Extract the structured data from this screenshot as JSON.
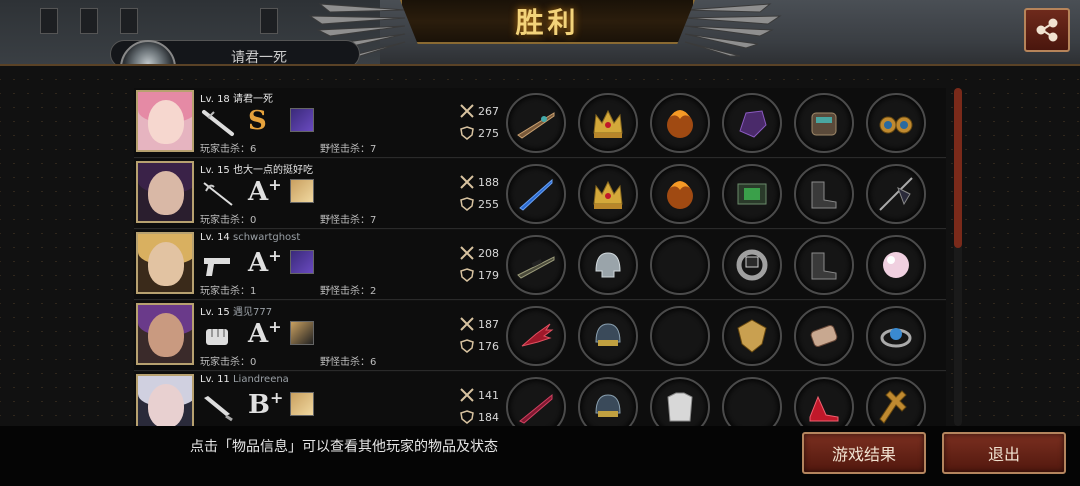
{
  "header": {
    "title": "胜利",
    "team_name": "请君一死"
  },
  "players": [
    {
      "level_text": "Lv. 18",
      "name": "请君一死",
      "name_is_latin": false,
      "weapon": "baton-icon",
      "rank": "S",
      "rank_plus": "",
      "player_kills": "玩家击杀：6",
      "monster_kills": "野怪击杀：7",
      "attack": "267",
      "defense": "275",
      "items": [
        "rifle-icon",
        "crown-icon",
        "flame-fist-icon",
        "purple-gauntlet-icon",
        "armored-glove-icon",
        "goggles-icon"
      ]
    },
    {
      "level_text": "Lv. 15",
      "name": "也大一点的挺好吃",
      "name_is_latin": false,
      "weapon": "rapier-icon",
      "rank": "A",
      "rank_plus": "+",
      "player_kills": "玩家击杀：0",
      "monster_kills": "野怪击杀：7",
      "attack": "188",
      "defense": "255",
      "items": [
        "blue-blade-icon",
        "crown-icon",
        "flame-fist-icon",
        "circuit-board-icon",
        "combat-boots-icon",
        "flag-spear-icon"
      ]
    },
    {
      "level_text": "Lv. 14",
      "name": "schwartghost",
      "name_is_latin": true,
      "weapon": "pistol-icon",
      "rank": "A",
      "rank_plus": "+",
      "player_kills": "玩家击杀：1",
      "monster_kills": "野怪击杀：2",
      "attack": "208",
      "defense": "179",
      "items": [
        "sniper-rifle-icon",
        "steel-helmet-icon",
        "",
        "power-ring-icon",
        "combat-boots-icon",
        "pearl-icon"
      ]
    },
    {
      "level_text": "Lv. 15",
      "name": "遇见777",
      "name_is_latin": false,
      "weapon": "fist-icon",
      "rank": "A",
      "rank_plus": "+",
      "player_kills": "玩家击杀：0",
      "monster_kills": "野怪击杀：6",
      "attack": "187",
      "defense": "176",
      "items": [
        "claw-gauntlet-icon",
        "tactical-helmet-icon",
        "",
        "gold-shield-icon",
        "bandaged-arm-icon",
        "orb-bracelet-icon"
      ]
    },
    {
      "level_text": "Lv. 11",
      "name": "Liandreena",
      "name_is_latin": true,
      "weapon": "knife-icon",
      "rank": "B",
      "rank_plus": "+",
      "player_kills": "",
      "monster_kills": "",
      "attack": "141",
      "defense": "184",
      "items": [
        "red-crossbow-icon",
        "tactical-helmet-icon",
        "white-armor-icon",
        "",
        "red-heels-icon",
        "cross-icon"
      ]
    }
  ],
  "footer": {
    "hint": "点击「物品信息」可以查看其他玩家的物品及状态",
    "results_button": "游戏结果",
    "exit_button": "退出"
  },
  "colors": {
    "accent_gold": "#f3d37a",
    "button_red": "#7a2f20",
    "frame_gold": "#b7a170"
  }
}
